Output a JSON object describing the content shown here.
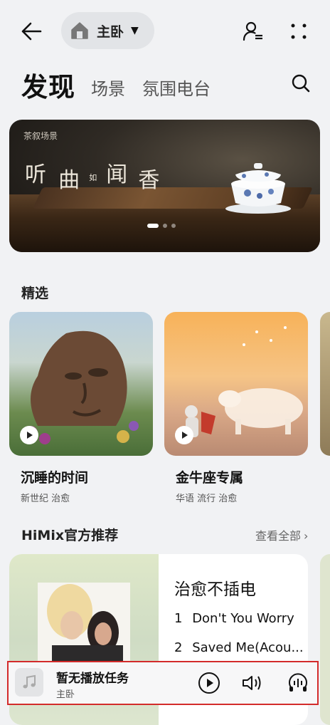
{
  "header": {
    "back_icon": "arrow-left-icon",
    "room_icon": "home-icon",
    "room_name": "主卧",
    "room_caret_icon": "caret-down-icon",
    "user_icon": "user-settings-icon",
    "more_icon": "more-dots-icon"
  },
  "tabs": {
    "active": "发现",
    "items": [
      "场景",
      "氛围电台"
    ],
    "search_icon": "search-icon"
  },
  "banner": {
    "small_title": "茶叙场景",
    "big_title_1": "听",
    "big_title_2": "曲",
    "big_title_3": "如",
    "big_title_4": "闻",
    "big_title_5": "香",
    "slide_count": 3,
    "active_slide": 1
  },
  "featured": {
    "title": "精选",
    "items": [
      {
        "title": "沉睡的时间",
        "tags": "新世纪 治愈"
      },
      {
        "title": "金牛座专属",
        "tags": "华语 流行 治愈"
      }
    ]
  },
  "himix": {
    "title": "HiMix官方推荐",
    "see_all": "查看全部",
    "playlist_title": "治愈不插电",
    "tracks": [
      {
        "num": "1",
        "name": "Don't You Worry"
      },
      {
        "num": "2",
        "name": "Saved Me(Acou..."
      }
    ]
  },
  "mini_player": {
    "title": "暂无播放任务",
    "room": "主卧",
    "play_icon": "play-icon",
    "volume_icon": "volume-icon",
    "audio_icon": "audio-settings-icon"
  },
  "colors": {
    "background": "#f1f2f4",
    "highlight_border": "#d32b2b"
  }
}
